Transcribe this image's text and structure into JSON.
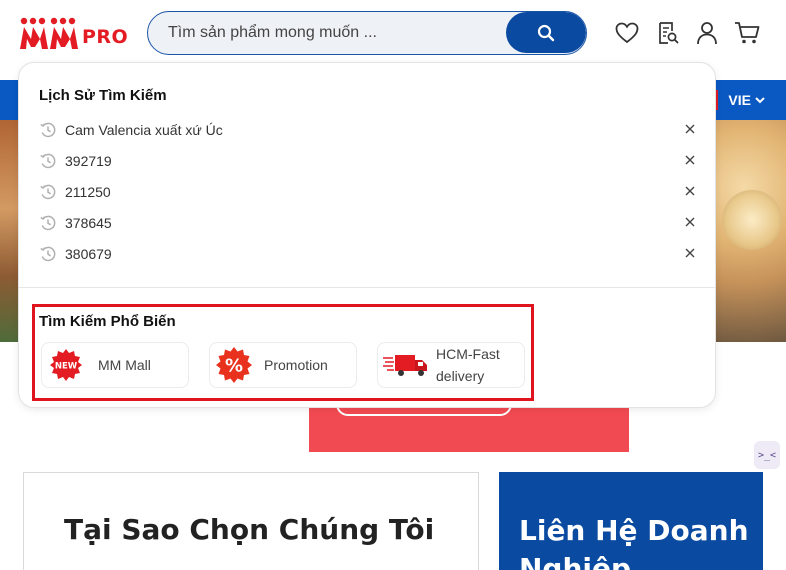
{
  "header": {
    "logo_text": "PRO",
    "search": {
      "placeholder": "Tìm sản phẩm mong muốn ..."
    }
  },
  "nav": {
    "language": "VIE"
  },
  "dropdown": {
    "history_title": "Lịch Sử Tìm Kiếm",
    "history": [
      {
        "text": "Cam Valencia xuất xứ Úc"
      },
      {
        "text": "392719"
      },
      {
        "text": "211250"
      },
      {
        "text": "378645"
      },
      {
        "text": "380679"
      }
    ],
    "popular_title": "Tìm Kiếm Phổ Biến",
    "popular": [
      {
        "label": "MM Mall",
        "icon": "new-badge-icon",
        "badge": "NEW"
      },
      {
        "label": "Promotion",
        "icon": "percent-badge-icon",
        "badge": "%"
      },
      {
        "label": "HCM-Fast delivery",
        "icon": "delivery-truck-icon"
      }
    ]
  },
  "page": {
    "why_title": "Tại Sao Chọn Chúng Tôi",
    "contact_title": "Liên Hệ Doanh Nghiệp",
    "side_widget": ">_<"
  },
  "colors": {
    "brand_red": "#e31b23",
    "brand_blue": "#0a4aa0",
    "nav_blue": "#0a58c2",
    "highlight_red": "#e0141e"
  }
}
